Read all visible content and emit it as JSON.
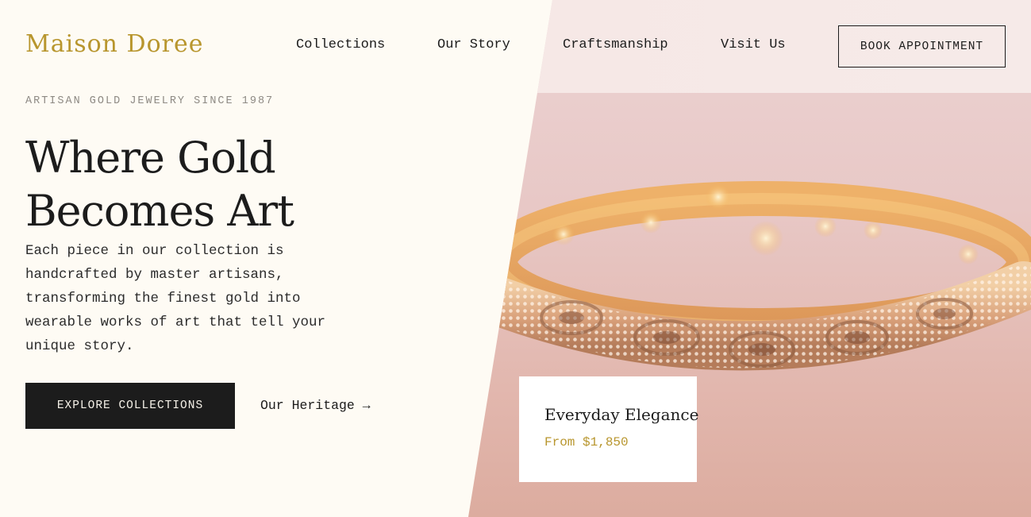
{
  "brand": {
    "name": "Maison Doree"
  },
  "nav": {
    "items": [
      {
        "label": "Collections"
      },
      {
        "label": "Our Story"
      },
      {
        "label": "Craftsmanship"
      },
      {
        "label": "Visit Us"
      }
    ],
    "cta_label": "BOOK APPOINTMENT"
  },
  "hero": {
    "eyebrow": "ARTISAN GOLD JEWELRY SINCE 1987",
    "headline_line1": "Where Gold",
    "headline_line2": "Becomes Art",
    "description": "Each piece in our collection is handcrafted by master artisans, transforming the finest gold into wearable works of art that tell your unique story.",
    "primary_cta": "EXPLORE COLLECTIONS",
    "secondary_cta": "Our Heritage →"
  },
  "feature_card": {
    "title": "Everyday Elegance",
    "price": "From $1,850"
  },
  "colors": {
    "page_bg": "#fefbf4",
    "gold_accent": "#b8962e",
    "ink": "#1c1c1c",
    "photo_bg": "#e8c8c6"
  },
  "image": {
    "subject": "gold-bangle-photo-icon"
  }
}
